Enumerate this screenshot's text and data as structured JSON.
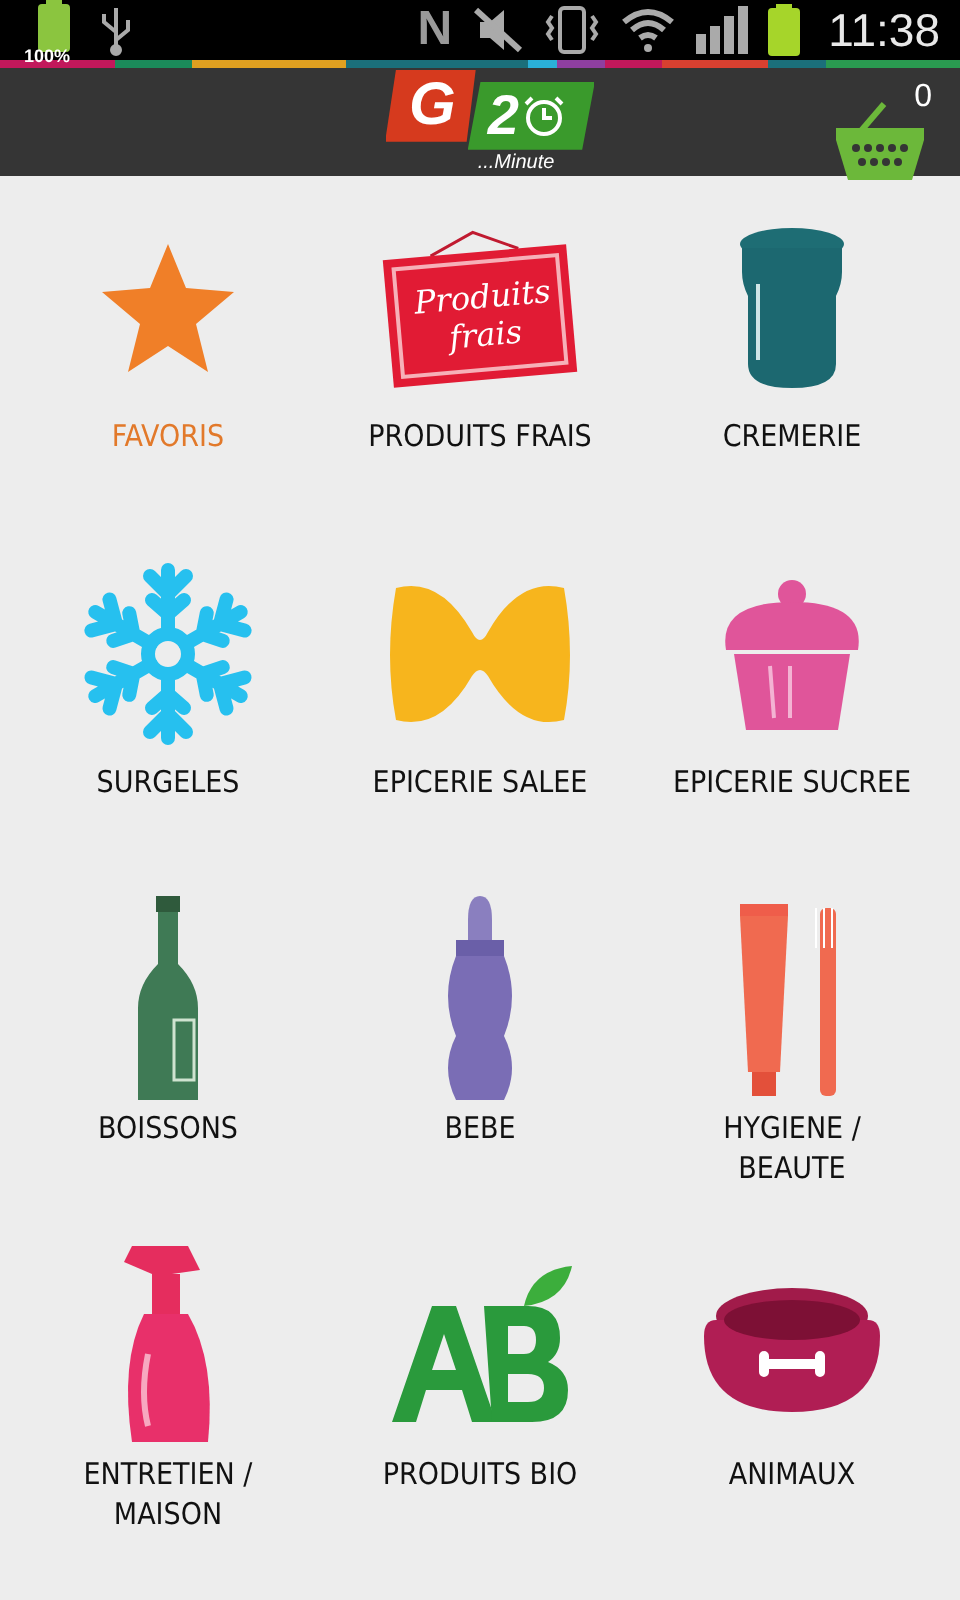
{
  "status_bar": {
    "battery_text": "100%",
    "nfc_letter": "N",
    "time": "11:38"
  },
  "header": {
    "logo": {
      "letter": "G",
      "digit": "2",
      "tagline": "...Minute"
    },
    "cart_count": "0"
  },
  "categories": [
    {
      "kind": "star",
      "label": "FAVORIS",
      "selected": true
    },
    {
      "kind": "sign",
      "label": "PRODUITS FRAIS",
      "selected": false,
      "sign_text": "Produits\nfrais"
    },
    {
      "kind": "jar",
      "label": "CREMERIE",
      "selected": false
    },
    {
      "kind": "snowflake",
      "label": "SURGELES",
      "selected": false
    },
    {
      "kind": "pasta",
      "label": "EPICERIE SALEE",
      "selected": false
    },
    {
      "kind": "cupcake",
      "label": "EPICERIE SUCREE",
      "selected": false
    },
    {
      "kind": "bottle",
      "label": "BOISSONS",
      "selected": false
    },
    {
      "kind": "baby-bottle",
      "label": "BEBE",
      "selected": false
    },
    {
      "kind": "toothpaste",
      "label": "HYGIENE /\nBEAUTE",
      "selected": false
    },
    {
      "kind": "spray",
      "label": "ENTRETIEN /\nMAISON",
      "selected": false
    },
    {
      "kind": "bio",
      "label": "PRODUITS BIO",
      "selected": false
    },
    {
      "kind": "bowl",
      "label": "ANIMAUX",
      "selected": false
    }
  ]
}
